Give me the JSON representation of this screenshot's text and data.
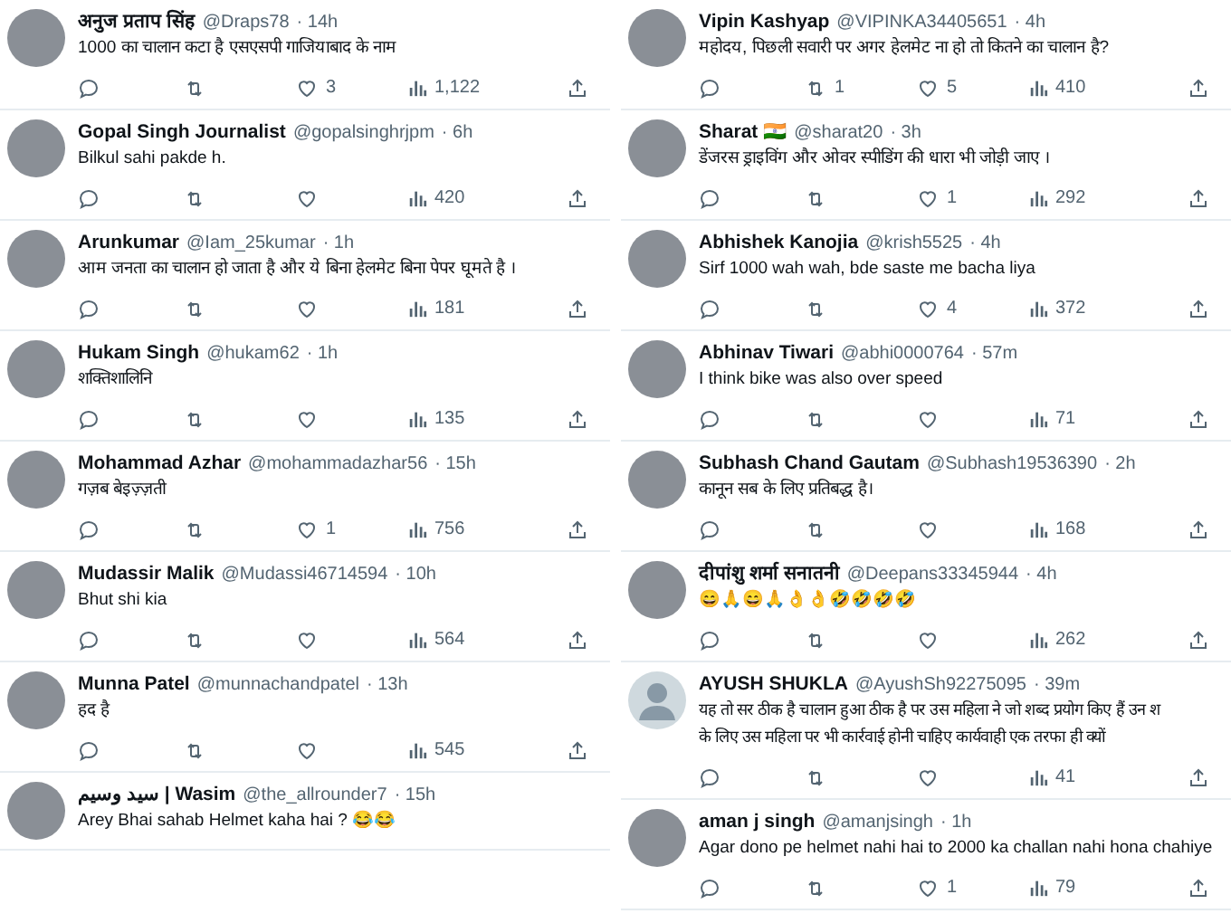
{
  "columns": [
    {
      "tweets": [
        {
          "kind": "photo",
          "name": "अनुज प्रताप सिंह",
          "handle": "@Draps78",
          "time": "· 14h",
          "lines": [
            "1000 का चालान कटा है एसएसपी गाजियाबाद के नाम"
          ],
          "actions": {
            "likes": "3",
            "views": "1,122"
          }
        },
        {
          "kind": "photo",
          "name": "Gopal Singh Journalist",
          "handle": "@gopalsinghrjpm",
          "time": "· 6h",
          "lines": [
            "Bilkul sahi pakde h."
          ],
          "actions": {
            "views": "420"
          }
        },
        {
          "kind": "photo",
          "name": "Arunkumar",
          "handle": "@Iam_25kumar",
          "time": "· 1h",
          "lines": [
            "आम जनता का चालान हो जाता है और ये बिना हेलमेट बिना पेपर घूमते है ।"
          ],
          "actions": {
            "views": "181"
          }
        },
        {
          "kind": "photo",
          "name": "Hukam Singh",
          "handle": "@hukam62",
          "time": "· 1h",
          "lines": [
            "शक्तिशालिनि"
          ],
          "actions": {
            "views": "135"
          }
        },
        {
          "kind": "photo",
          "name": "Mohammad Azhar",
          "handle": "@mohammadazhar56",
          "time": "· 15h",
          "lines": [
            "गज़ब बेइज़्ज़ती"
          ],
          "actions": {
            "likes": "1",
            "views": "756"
          }
        },
        {
          "kind": "photo",
          "name": "Mudassir Malik",
          "handle": "@Mudassi46714594",
          "time": "· 10h",
          "lines": [
            "Bhut shi kia"
          ],
          "actions": {
            "views": "564"
          }
        },
        {
          "kind": "photo",
          "name": "Munna Patel",
          "handle": "@munnachandpatel",
          "time": "· 13h",
          "lines": [
            "हद है"
          ],
          "actions": {
            "views": "545"
          }
        },
        {
          "kind": "photo",
          "name": "سید وسیم | Wasim",
          "handle": "@the_allrounder7",
          "time": "· 15h",
          "lines": [
            "Arey Bhai sahab Helmet kaha hai ? 😂😂"
          ]
        }
      ]
    },
    {
      "tweets": [
        {
          "kind": "photo",
          "name": "Vipin Kashyap",
          "handle": "@VIPINKA34405651",
          "time": "· 4h",
          "lines": [
            "महोदय, पिछली सवारी पर अगर हेलमेट ना हो तो कितने का चालान है?"
          ],
          "actions": {
            "retweets": "1",
            "likes": "5",
            "views": "410"
          }
        },
        {
          "kind": "photo",
          "name": "Sharat 🇮🇳",
          "handle": "@sharat20",
          "time": "· 3h",
          "lines": [
            "डेंजरस ड्राइविंग और ओवर स्पीडिंग की धारा भी जोड़ी जाए ।"
          ],
          "actions": {
            "likes": "1",
            "views": "292"
          }
        },
        {
          "kind": "photo",
          "name": "Abhishek Kanojia",
          "handle": "@krish5525",
          "time": "· 4h",
          "lines": [
            "Sirf 1000 wah wah,  bde saste me bacha liya"
          ],
          "actions": {
            "likes": "4",
            "views": "372"
          }
        },
        {
          "kind": "photo",
          "name": "Abhinav Tiwari",
          "handle": "@abhi0000764",
          "time": "· 57m",
          "lines": [
            "I think bike was also over speed"
          ],
          "actions": {
            "views": "71"
          }
        },
        {
          "kind": "photo",
          "name": "Subhash Chand Gautam",
          "handle": "@Subhash19536390",
          "time": "· 2h",
          "lines": [
            "कानून सब के लिए प्रतिबद्ध है।"
          ],
          "actions": {
            "views": "168"
          }
        },
        {
          "kind": "photo",
          "name": "दीपांशु शर्मा सनातनी",
          "handle": "@Deepans33345944",
          "time": "· 4h",
          "lines": [
            "😄🙏😄🙏👌👌🤣🤣🤣🤣"
          ],
          "actions": {
            "views": "262"
          }
        },
        {
          "kind": "default",
          "name": "AYUSH SHUKLA",
          "handle": "@AyushSh92275095",
          "time": "· 39m",
          "lines": [
            "यह तो सर ठीक है चालान हुआ ठीक है पर उस महिला ने जो शब्द प्रयोग किए हैं उन श",
            "के लिए उस महिला पर भी कार्रवाई होनी चाहिए कार्यवाही एक तरफा ही क्यों"
          ],
          "actions": {
            "views": "41"
          }
        },
        {
          "kind": "photo",
          "name": "aman j singh",
          "handle": "@amanjsingh",
          "time": "· 1h",
          "lines": [
            "Agar dono pe helmet nahi hai to 2000 ka challan nahi hona chahiye"
          ],
          "actions": {
            "likes": "1",
            "views": "79"
          }
        }
      ]
    }
  ]
}
